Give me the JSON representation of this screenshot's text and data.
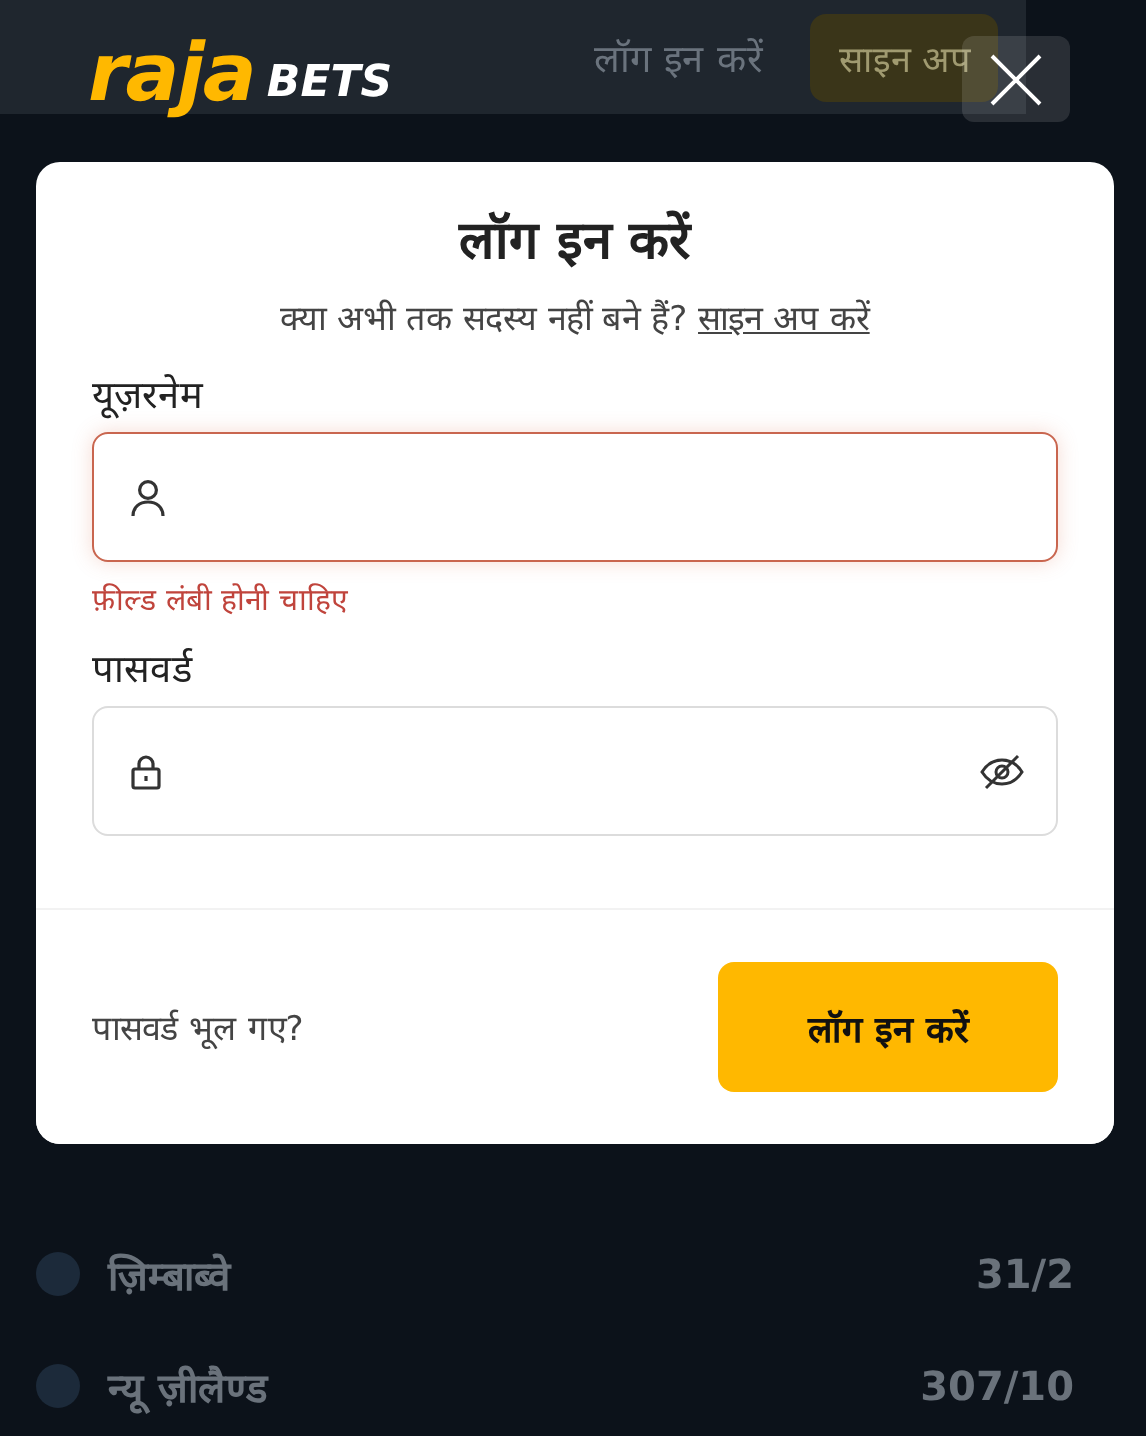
{
  "app_header": {
    "login_link": "लॉग इन करें",
    "signup_button": "साइन अप"
  },
  "scores": [
    {
      "team": "ज़िम्बाब्वे",
      "score": "31/2"
    },
    {
      "team": "न्यू ज़ीलैण्ड",
      "score": "307/10"
    }
  ],
  "overlay_logo": {
    "part_1": "raja",
    "part_2": "BETS"
  },
  "login_dialog": {
    "title": "लॉग इन करें",
    "prompt": "क्या अभी तक सदस्य नहीं बने हैं?",
    "signup_link": "साइन अप करें",
    "fields": [
      {
        "kind": "username",
        "label": "यूज़रनेम",
        "invalid": true,
        "error": "फ़ील्ड लंबी होनी चाहिए"
      },
      {
        "kind": "password",
        "label": "पासवर्ड",
        "invalid": false
      }
    ],
    "forgot_link": "पासवर्ड भूल गए?",
    "submit_button": "लॉग इन करें"
  }
}
